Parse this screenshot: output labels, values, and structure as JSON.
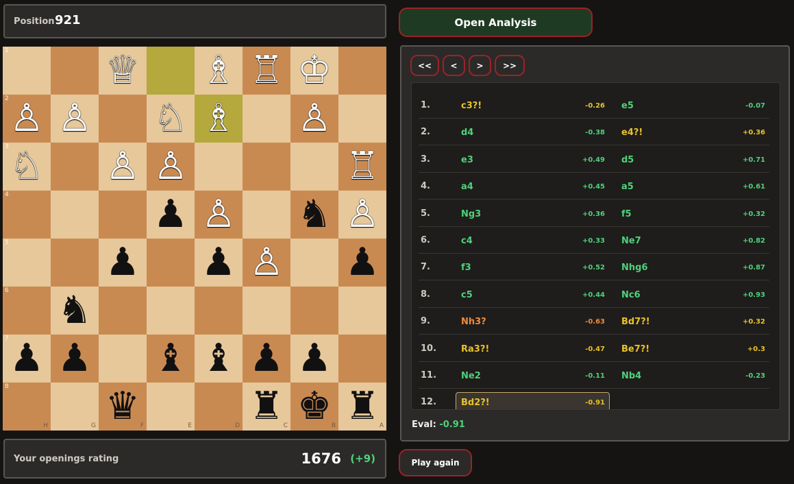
{
  "position": {
    "label": "Position",
    "number": "921"
  },
  "buttons": {
    "open_analysis": "Open Analysis",
    "play_again": "Play again"
  },
  "nav": {
    "first": "<<",
    "prev": "<",
    "next": ">",
    "last": ">>"
  },
  "rating": {
    "label": "Your openings rating",
    "value": "1676",
    "delta": "(+9)"
  },
  "eval": {
    "label": "Eval:",
    "value": "-0.91"
  },
  "colors": {
    "green": "#4fd17b",
    "yellow": "#e8c22a",
    "orange": "#f08a3c",
    "border_red": "#9b2328"
  },
  "board": {
    "rank_labels": [
      "1",
      "2",
      "3",
      "4",
      "5",
      "6",
      "7",
      "8"
    ],
    "file_labels": [
      "H",
      "G",
      "F",
      "E",
      "D",
      "C",
      "B",
      "A"
    ],
    "highlights": [
      [
        0,
        3
      ],
      [
        1,
        4
      ]
    ],
    "rows": [
      [
        "",
        "",
        "wQ",
        "",
        "wB",
        "wR",
        "wK",
        ""
      ],
      [
        "wP",
        "wP",
        "",
        "wN",
        "wB",
        "",
        "wP",
        ""
      ],
      [
        "wN",
        "",
        "wP",
        "wP",
        "",
        "",
        "",
        "wR"
      ],
      [
        "",
        "",
        "",
        "bP",
        "wP",
        "",
        "bN",
        "wP"
      ],
      [
        "",
        "",
        "bP",
        "",
        "bP",
        "wP",
        "",
        "bP"
      ],
      [
        "",
        "bN",
        "",
        "",
        "",
        "",
        "",
        ""
      ],
      [
        "bP",
        "bP",
        "",
        "bB",
        "bB",
        "bP",
        "bP",
        ""
      ],
      [
        "",
        "",
        "bQ",
        "",
        "",
        "bR",
        "bK",
        "bR"
      ]
    ]
  },
  "moves": [
    {
      "n": "1.",
      "w": "c3?!",
      "wc": "yellow",
      "we": "-0.26",
      "wec": "yellow",
      "b": "e5",
      "bc": "green",
      "be": "-0.07",
      "bec": "green"
    },
    {
      "n": "2.",
      "w": "d4",
      "wc": "green",
      "we": "-0.38",
      "wec": "green",
      "b": "e4?!",
      "bc": "yellow",
      "be": "+0.36",
      "bec": "yellow"
    },
    {
      "n": "3.",
      "w": "e3",
      "wc": "green",
      "we": "+0.49",
      "wec": "green",
      "b": "d5",
      "bc": "green",
      "be": "+0.71",
      "bec": "green"
    },
    {
      "n": "4.",
      "w": "a4",
      "wc": "green",
      "we": "+0.45",
      "wec": "green",
      "b": "a5",
      "bc": "green",
      "be": "+0.61",
      "bec": "green"
    },
    {
      "n": "5.",
      "w": "Ng3",
      "wc": "green",
      "we": "+0.36",
      "wec": "green",
      "b": "f5",
      "bc": "green",
      "be": "+0.32",
      "bec": "green"
    },
    {
      "n": "6.",
      "w": "c4",
      "wc": "green",
      "we": "+0.33",
      "wec": "green",
      "b": "Ne7",
      "bc": "green",
      "be": "+0.82",
      "bec": "green"
    },
    {
      "n": "7.",
      "w": "f3",
      "wc": "green",
      "we": "+0.52",
      "wec": "green",
      "b": "Nhg6",
      "bc": "green",
      "be": "+0.87",
      "bec": "green"
    },
    {
      "n": "8.",
      "w": "c5",
      "wc": "green",
      "we": "+0.44",
      "wec": "green",
      "b": "Nc6",
      "bc": "green",
      "be": "+0.93",
      "bec": "green"
    },
    {
      "n": "9.",
      "w": "Nh3?",
      "wc": "orange",
      "we": "-0.63",
      "wec": "orange",
      "b": "Bd7?!",
      "bc": "yellow",
      "be": "+0.32",
      "bec": "yellow"
    },
    {
      "n": "10.",
      "w": "Ra3?!",
      "wc": "yellow",
      "we": "-0.47",
      "wec": "yellow",
      "b": "Be7?!",
      "bc": "yellow",
      "be": "+0.3",
      "bec": "yellow"
    },
    {
      "n": "11.",
      "w": "Ne2",
      "wc": "green",
      "we": "-0.11",
      "wec": "green",
      "b": "Nb4",
      "bc": "green",
      "be": "-0.23",
      "bec": "green"
    },
    {
      "n": "12.",
      "w": "Bd2?!",
      "wc": "yellow",
      "we": "-0.91",
      "wec": "yellow",
      "b": "",
      "bc": "green",
      "be": "",
      "bec": "green"
    }
  ]
}
